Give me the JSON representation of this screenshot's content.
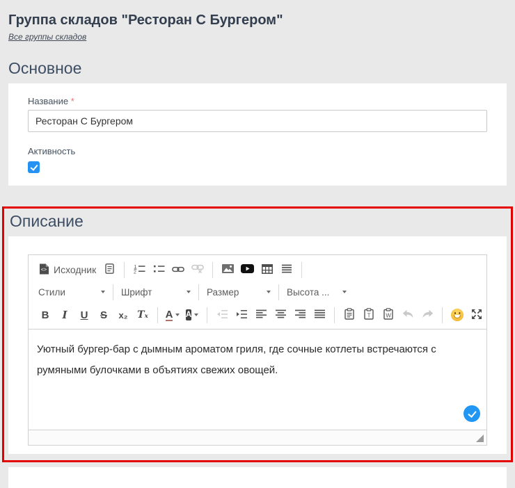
{
  "header": {
    "title": "Группа складов \"Ресторан С Бургером\"",
    "back_link": "Все группы складов"
  },
  "main_section": {
    "heading": "Основное",
    "fields": {
      "name": {
        "label": "Название",
        "required_mark": "*",
        "value": "Ресторан С Бургером"
      },
      "activity": {
        "label": "Активность",
        "checked": true
      }
    }
  },
  "description_section": {
    "heading": "Описание",
    "highlighted": true,
    "highlight_color": "#e50000",
    "editor": {
      "toolbar": {
        "source_label": "Исходник",
        "styles_label": "Стили",
        "font_label": "Шрифт",
        "size_label": "Размер",
        "line_height_label": "Высота ...",
        "bold": "B",
        "italic": "I",
        "underline": "U",
        "strike": "S",
        "subscript": "x₂",
        "remove_format": "Tₓ",
        "text_color_letter": "A",
        "bg_color_letter": "A",
        "row1_icons": [
          "source-icon",
          "templates-icon",
          "numbered-list-icon",
          "bulleted-list-icon",
          "link-icon",
          "unlink-icon",
          "image-icon",
          "youtube-icon",
          "table-icon",
          "horizontal-lines-icon"
        ],
        "row3_icons": [
          "outdent-icon",
          "indent-icon",
          "align-left-icon",
          "align-center-icon",
          "align-right-icon",
          "justify-icon",
          "paste-icon",
          "paste-text-icon",
          "paste-word-icon",
          "undo-icon",
          "redo-icon",
          "smiley-icon",
          "maximize-icon"
        ],
        "disabled_items": [
          "unlink",
          "outdent",
          "undo",
          "redo"
        ]
      },
      "content_text": "Уютный бургер-бар с дымным ароматом гриля, где сочные котлеты встречаются с румяными булочками в объятиях свежих овощей."
    }
  },
  "colors": {
    "page_background": "#e9e9e9",
    "card_background": "#ffffff",
    "heading_text": "#3d4d63",
    "accent_blue": "#2196f3",
    "highlight_red": "#e50000",
    "required_red": "#e57373",
    "toolbar_icon_gray": "#565656",
    "disabled_gray": "#c9c9c9"
  }
}
